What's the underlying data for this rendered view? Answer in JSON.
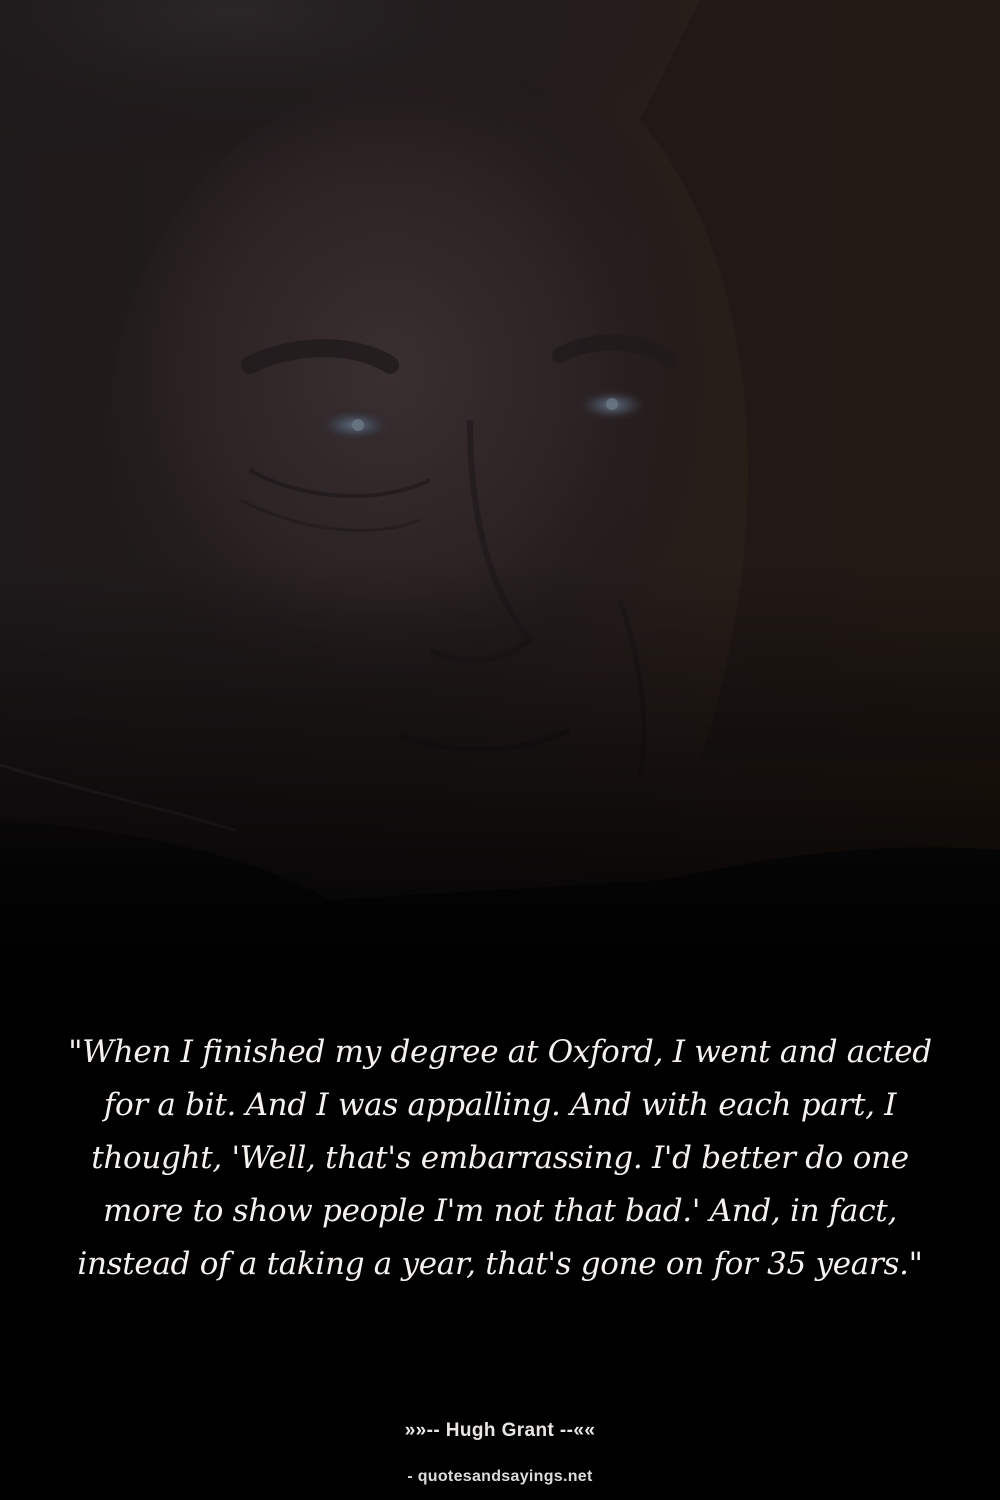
{
  "quote": {
    "text": "\"When I finished my degree at Oxford, I went and acted for a bit. And I was appalling. And with each part, I thought, 'Well, that's embarrassing. I'd better do one more to show people I'm not that bad.' And, in fact, instead of a taking a year, that's gone on for 35 years.\"",
    "author_line": "»»-- Hugh Grant --««",
    "source_line": "- quotesandsayings.net"
  },
  "colors": {
    "background": "#000000",
    "text": "#f4f1ee"
  },
  "background_image": {
    "subject": "dimly lit close-up portrait of a man's face"
  }
}
